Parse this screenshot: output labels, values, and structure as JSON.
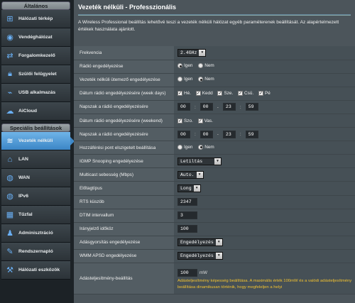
{
  "sidebar": {
    "general_header": "Általános",
    "general_items": [
      {
        "label": "Hálózati térkép",
        "icon": "network-map-icon"
      },
      {
        "label": "Vendéghálózat",
        "icon": "guest-network-icon"
      },
      {
        "label": "Forgalomkezelő",
        "icon": "traffic-manager-icon"
      },
      {
        "label": "Szülői felügyelet",
        "icon": "lock-icon"
      },
      {
        "label": "USB alkalmazás",
        "icon": "usb-icon"
      },
      {
        "label": "AiCloud",
        "icon": "cloud-icon"
      }
    ],
    "advanced_header": "Speciális beállítások",
    "advanced_items": [
      {
        "label": "Vezeték nélküli",
        "icon": "wifi-icon",
        "active": true
      },
      {
        "label": "LAN",
        "icon": "home-icon"
      },
      {
        "label": "WAN",
        "icon": "globe-icon"
      },
      {
        "label": "IPv6",
        "icon": "ipv6-globe-icon"
      },
      {
        "label": "Tűzfal",
        "icon": "firewall-icon"
      },
      {
        "label": "Adminisztráció",
        "icon": "admin-icon"
      },
      {
        "label": "Rendszernapló",
        "icon": "log-icon"
      },
      {
        "label": "Hálózati eszközök",
        "icon": "tools-icon"
      }
    ]
  },
  "main": {
    "title": "Vezeték nélküli - Professzionális",
    "description": "A Wireless Professional beállítás lehetővé teszi a vezeték nélküli hálózat egyéb paraméterenek beállítását. Az alapértelmezett értékek használata ajánlott."
  },
  "settings": {
    "frequency": {
      "label": "Frekvencia",
      "value": "2.4GHz"
    },
    "radio_enable": {
      "label": "Rádió engedélyezése",
      "yes": "Igen",
      "no": "Nem"
    },
    "scheduler_enable": {
      "label": "Vezeték nélküli ütemező engedélyezése",
      "yes": "Igen",
      "no": "Nem"
    },
    "radio_weekdays": {
      "label": "Dátum rádió engedélyezésére (week days)",
      "days": [
        "Hé.",
        "Kedd",
        "Sze.",
        "Csü.",
        "Pé"
      ]
    },
    "time_weekdays": {
      "label": "Napszak a rádió engedélyezésére",
      "h1": "00",
      "m1": "00",
      "h2": "23",
      "m2": "59"
    },
    "radio_weekend": {
      "label": "Dátum rádió engedélyezésére (weekend)",
      "days": [
        "Szo.",
        "Vas."
      ]
    },
    "time_weekend": {
      "label": "Napszak a rádió engedélyezésére",
      "h1": "00",
      "m1": "00",
      "h2": "23",
      "m2": "59"
    },
    "ap_isolation": {
      "label": "Hozzáférési pont elszigetelt beállítása",
      "yes": "Igen",
      "no": "Nem"
    },
    "igmp": {
      "label": "IGMP Snooping engedélyezése",
      "value": "Letiltás"
    },
    "multicast": {
      "label": "Multicast sebesség (Mbps)",
      "value": "Auto."
    },
    "preamble": {
      "label": "Előtagtípus",
      "value": "Long"
    },
    "rts": {
      "label": "RTS küszöb",
      "value": "2347"
    },
    "dtim": {
      "label": "DTIM intervallum",
      "value": "3"
    },
    "beacon": {
      "label": "Irányjelző időköz",
      "value": "100"
    },
    "tx_burst": {
      "label": "Adásgyorsítás engedélyezése",
      "value": "Engedélyezés"
    },
    "wmm_apsd": {
      "label": "WMM APSD engedélyezése",
      "value": "Engedélyezés"
    },
    "tx_power": {
      "label": "Adásteljesítmény-beállítás",
      "value": "100",
      "unit": "mW",
      "hint": "Adásteljesítmény képesség beállítása. A maximális érték 100mW és a valódi adásteljesítmény beállítása dinamikusan történik, hogy megfeleljen a helyi"
    }
  }
}
